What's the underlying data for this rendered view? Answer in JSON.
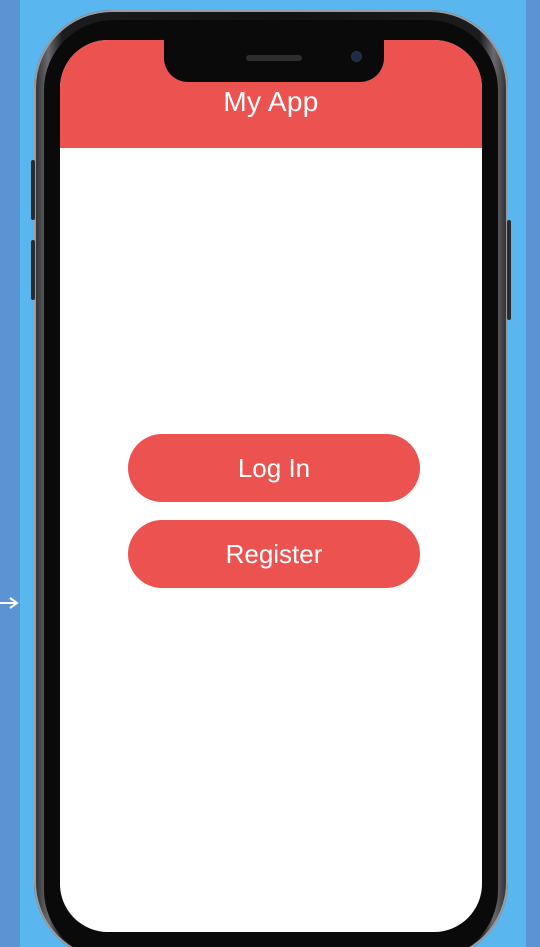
{
  "app": {
    "title": "My App",
    "accent_color": "#eb5250"
  },
  "actions": {
    "login_label": "Log In",
    "register_label": "Register"
  },
  "background": {
    "color": "#5ab6ee"
  }
}
